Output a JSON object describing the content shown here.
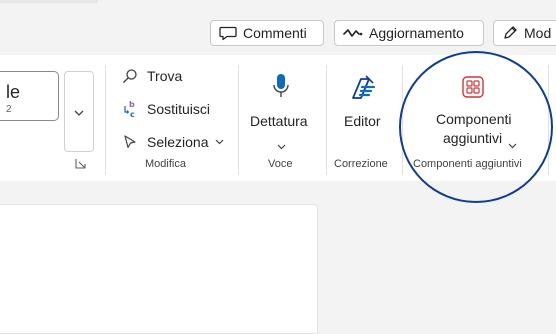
{
  "toolbar": {
    "comments_label": "Commenti",
    "catchup_label": "Aggiornamento",
    "edit_label": "Mod"
  },
  "styles": {
    "current_style": "le",
    "current_style_sub": "2"
  },
  "editing_group": {
    "find_label": "Trova",
    "replace_label": "Sostituisci",
    "select_label": "Seleziona",
    "group_label": "Modifica"
  },
  "voice_group": {
    "dictate_label": "Dettatura",
    "group_label": "Voce"
  },
  "proofing_group": {
    "editor_label": "Editor",
    "group_label": "Correzione"
  },
  "addins_group": {
    "addins_label_line1": "Componenti",
    "addins_label_line2": "aggiuntivi",
    "group_label": "Componenti aggiuntivi"
  },
  "colors": {
    "accent_blue": "#0f6cbd",
    "addins_icon": "#d13438",
    "highlight_circle": "#0f3d91"
  }
}
